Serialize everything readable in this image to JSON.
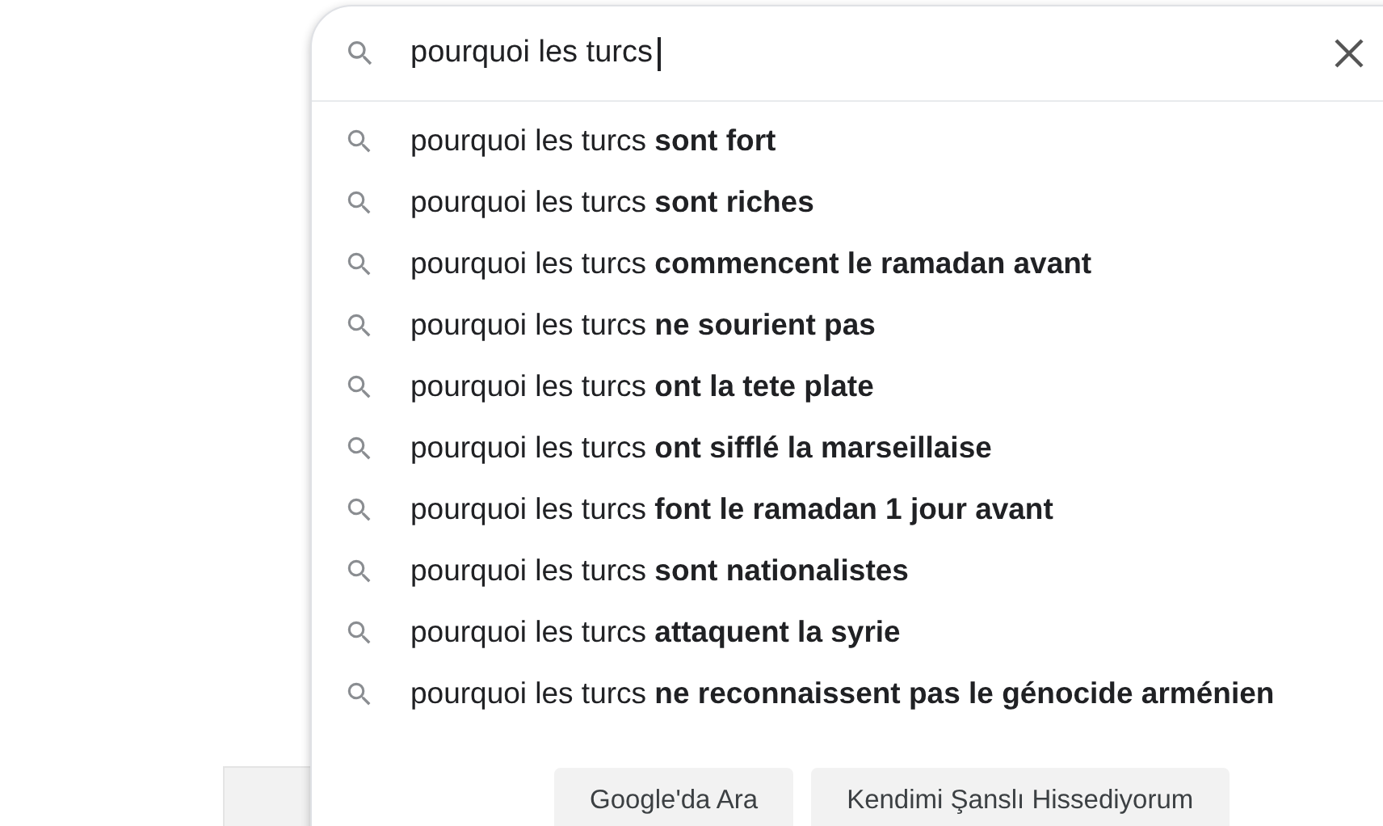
{
  "search": {
    "value": "pourquoi les turcs"
  },
  "suggestions": [
    "pourquoi les turcs **sont fort**",
    "pourquoi les turcs **sont riches**",
    "pourquoi les turcs **commencent le ramadan avant**",
    "pourquoi les turcs **ne sourient pas**",
    "pourquoi les turcs **ont la tete plate**",
    "pourquoi les turcs **ont sifflé la marseillaise**",
    "pourquoi les turcs **font le ramadan 1 jour avant**",
    "pourquoi les turcs **sont nationalistes**",
    "pourquoi les turcs **attaquent la syrie**",
    "pourquoi les turcs **ne reconnaissent pas le génocide arménien**"
  ],
  "buttons": [
    "Google'da Ara",
    "Kendimi Şanslı Hissediyorum"
  ]
}
